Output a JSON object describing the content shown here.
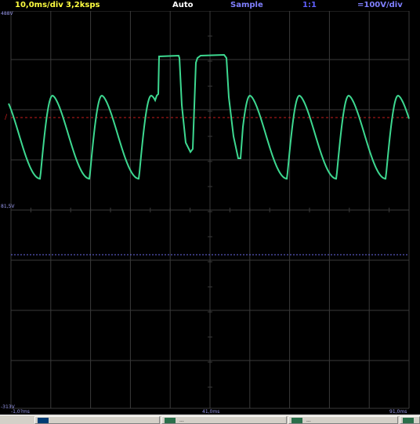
{
  "status": {
    "timebase": "10,0ms/div",
    "sample_rate": "3,2ksps",
    "trigger_mode": "Auto",
    "acq_mode": "Sample",
    "probe": "1:1",
    "volts_div": "=100V/div"
  },
  "labels": {
    "top_voltage": "488V",
    "mid_voltage": "81,5V",
    "bottom_voltage": "-313V",
    "trigger_marker": "/",
    "time_left": "-1,0?ms",
    "time_mid": "41,0ms",
    "time_right": "91,0ms"
  },
  "colors": {
    "background": "#000000",
    "grid": "#3a3a3a",
    "trace": "#3dd890",
    "trigger_line": "#c81e1e",
    "reference_line": "#6a6ae6",
    "status_yellow": "#ffff40",
    "status_white": "#ffffff",
    "status_blue": "#8080ff",
    "label_blue": "#9a9af0"
  },
  "taskbar": {
    "buttons": [
      {
        "icon": "window-icon",
        "label": ""
      },
      {
        "icon": "scope-icon",
        "label": "..."
      },
      {
        "icon": "scope-icon",
        "label": "..."
      },
      {
        "icon": "scope-icon",
        "label": ""
      }
    ]
  }
}
